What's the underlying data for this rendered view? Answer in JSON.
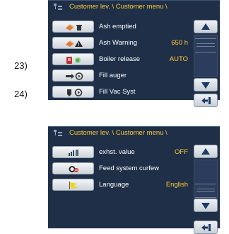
{
  "colors": {
    "panel_bg": "#1f2f48",
    "title_text": "#ffcc33",
    "value_text": "#ffcc33",
    "label_text": "#ffffff"
  },
  "side_labels": [
    "23)",
    "24)"
  ],
  "screen1": {
    "title": "Customer lev. \\ Customer menu \\",
    "rows": [
      {
        "label": "Ash emptied",
        "value": "",
        "icons": [
          "ash-tray-icon",
          "trash-can-icon"
        ]
      },
      {
        "label": "Ash Warning",
        "value": "650 h",
        "icons": [
          "ash-tray-icon",
          "warning-triangle-icon"
        ]
      },
      {
        "label": "Boiler release",
        "value": "AUTO",
        "icons": [
          "boiler-icon",
          "status-led-icon"
        ]
      },
      {
        "label": "Fill auger",
        "value": "",
        "icons": [
          "auger-icon",
          "circle-play-icon"
        ]
      },
      {
        "label": "Fill Vac Syst",
        "value": "",
        "icons": [
          "vacuum-icon",
          "circle-play-icon"
        ]
      }
    ]
  },
  "screen2": {
    "title": "Customer lev. \\ Customer menu \\",
    "rows": [
      {
        "label": "exhst. value",
        "value": "OFF",
        "icons": [
          "exhaust-gauge-icon"
        ]
      },
      {
        "label": "Feed system curfew",
        "value": "",
        "icons": [
          "curfew-clock-icon"
        ]
      },
      {
        "label": "Language",
        "value": "English",
        "icons": [
          "flag-icon"
        ]
      }
    ]
  }
}
